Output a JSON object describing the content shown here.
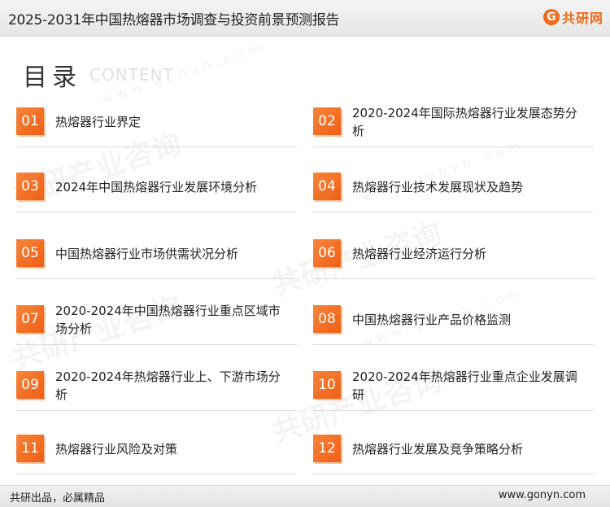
{
  "header": {
    "title": "2025-2031年中国热熔器市场调查与投资前景预测报告",
    "logo_mark": "G",
    "logo_text": "共研网"
  },
  "heading": {
    "title_cn": "目录",
    "title_en": "CONTENT"
  },
  "watermark": {
    "text": "共研产业咨询",
    "url": "www.gonyn.com"
  },
  "toc": [
    {
      "num": "01",
      "label": "热熔器行业界定"
    },
    {
      "num": "02",
      "label": "2020-2024年国际热熔器行业发展态势分析"
    },
    {
      "num": "03",
      "label": "2024年中国热熔器行业发展环境分析"
    },
    {
      "num": "04",
      "label": "热熔器行业技术发展现状及趋势"
    },
    {
      "num": "05",
      "label": "中国热熔器行业市场供需状况分析"
    },
    {
      "num": "06",
      "label": "热熔器行业经济运行分析"
    },
    {
      "num": "07",
      "label": "2020-2024年中国热熔器行业重点区域市场分析"
    },
    {
      "num": "08",
      "label": "中国热熔器行业产品价格监测"
    },
    {
      "num": "09",
      "label": "2020-2024年热熔器行业上、下游市场分析"
    },
    {
      "num": "10",
      "label": "2020-2024年热熔器行业重点企业发展调研"
    },
    {
      "num": "11",
      "label": "热熔器行业风险及对策"
    },
    {
      "num": "12",
      "label": "热熔器行业发展及竞争策略分析"
    }
  ],
  "footer": {
    "slogan": "共研出品，必属精品",
    "site": "www.gonyn.com"
  },
  "colors": {
    "accent": "#f26a1b"
  }
}
